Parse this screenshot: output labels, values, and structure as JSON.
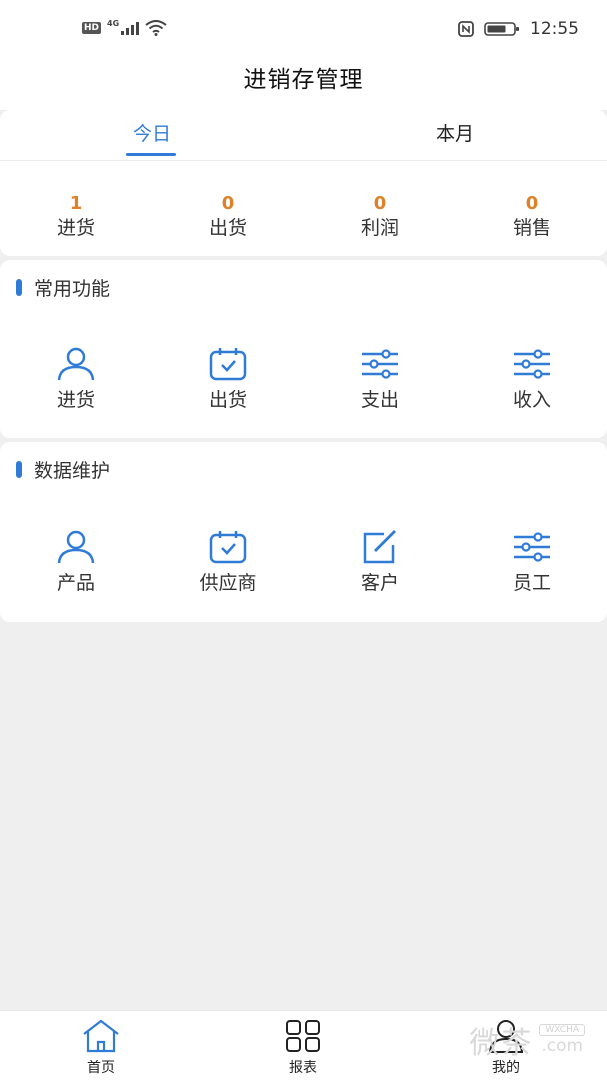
{
  "status_bar": {
    "hd": "HD",
    "network": "4G",
    "time": "12:55",
    "icons": [
      "signal-icon",
      "wifi-icon",
      "nfc-icon",
      "battery-icon"
    ]
  },
  "header": {
    "title": "进销存管理"
  },
  "tabs": [
    {
      "label": "今日",
      "active": true
    },
    {
      "label": "本月",
      "active": false
    }
  ],
  "summary": [
    {
      "value": "1",
      "label": "进货"
    },
    {
      "value": "0",
      "label": "出货"
    },
    {
      "value": "0",
      "label": "利润"
    },
    {
      "value": "0",
      "label": "销售"
    }
  ],
  "sections": [
    {
      "title": "常用功能",
      "items": [
        {
          "label": "进货",
          "icon": "person-icon"
        },
        {
          "label": "出货",
          "icon": "calendar-check-icon"
        },
        {
          "label": "支出",
          "icon": "sliders-icon"
        },
        {
          "label": "收入",
          "icon": "sliders-icon"
        }
      ]
    },
    {
      "title": "数据维护",
      "items": [
        {
          "label": "产品",
          "icon": "person-icon"
        },
        {
          "label": "供应商",
          "icon": "calendar-check-icon"
        },
        {
          "label": "客户",
          "icon": "edit-icon"
        },
        {
          "label": "员工",
          "icon": "sliders-icon"
        }
      ]
    }
  ],
  "bottom_nav": [
    {
      "label": "首页",
      "icon": "home-icon",
      "active": true
    },
    {
      "label": "报表",
      "icon": "grid-icon",
      "active": false
    },
    {
      "label": "我的",
      "icon": "user-icon",
      "active": false
    }
  ],
  "watermark": {
    "chars": "微茶",
    "brand": "WXCHA",
    "domain": ".com"
  },
  "colors": {
    "accent": "#2f7bd6",
    "stat_value": "#e0812a",
    "background": "#efefef",
    "card": "#ffffff"
  }
}
